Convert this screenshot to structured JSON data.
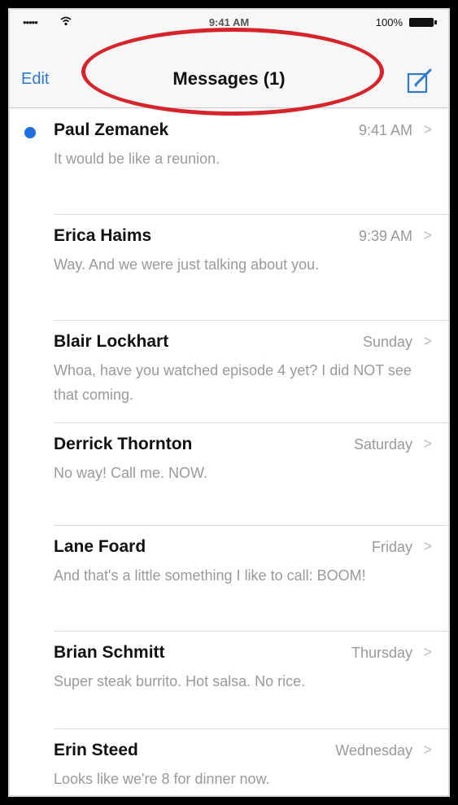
{
  "status_bar": {
    "signal": "•••••",
    "wifi_icon": "wifi-icon",
    "time": "9:41 AM",
    "battery": "100%"
  },
  "nav": {
    "edit_label": "Edit",
    "title": "Messages (1)",
    "compose_icon": "compose-icon"
  },
  "colors": {
    "accent": "#2f79d1",
    "unread_dot": "#1f6fe0",
    "annotation": "#d7242b"
  },
  "messages": [
    {
      "name": "Paul Zemanek",
      "date": "9:41 AM",
      "preview": "It would be like a reunion.",
      "unread": true
    },
    {
      "name": "Erica Haims",
      "date": "9:39 AM",
      "preview": "Way. And we were just talking about you.",
      "unread": false
    },
    {
      "name": "Blair Lockhart",
      "date": "Sunday",
      "preview": "Whoa, have you watched episode 4 yet? I did NOT see that coming.",
      "unread": false
    },
    {
      "name": "Derrick Thornton",
      "date": "Saturday",
      "preview": "No way! Call me. NOW.",
      "unread": false
    },
    {
      "name": "Lane Foard",
      "date": "Friday",
      "preview": "And that's a little something I like to call: BOOM!",
      "unread": false
    },
    {
      "name": "Brian Schmitt",
      "date": "Thursday",
      "preview": "Super steak burrito. Hot salsa. No rice.",
      "unread": false
    },
    {
      "name": "Erin Steed",
      "date": "Wednesday",
      "preview": "Looks like we're 8 for dinner now.",
      "unread": false
    }
  ]
}
